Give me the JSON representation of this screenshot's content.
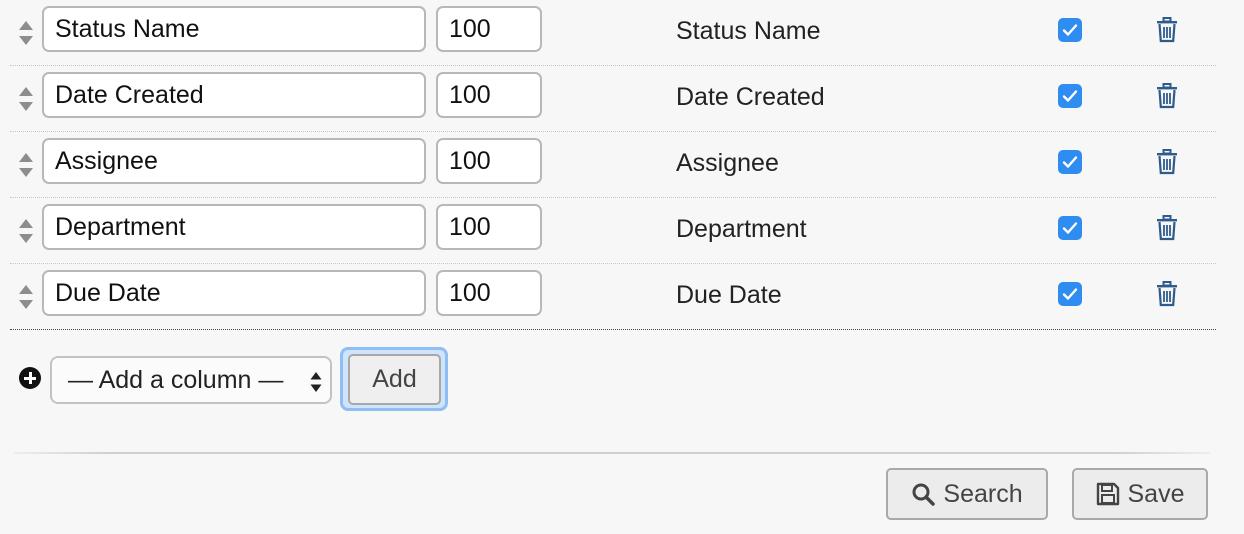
{
  "rows": [
    {
      "name": "Status Name",
      "width": "100",
      "label": "Status Name",
      "checked": true
    },
    {
      "name": "Date Created",
      "width": "100",
      "label": "Date Created",
      "checked": true
    },
    {
      "name": "Assignee",
      "width": "100",
      "label": "Assignee",
      "checked": true
    },
    {
      "name": "Department",
      "width": "100",
      "label": "Department",
      "checked": true
    },
    {
      "name": "Due Date",
      "width": "100",
      "label": "Due Date",
      "checked": true
    }
  ],
  "add_column": {
    "select_value": "— Add a column —",
    "add_label": "Add"
  },
  "footer": {
    "search_label": "Search",
    "save_label": "Save"
  },
  "colors": {
    "checkbox": "#2f8cf0",
    "trash_icon": "#2d5b8c",
    "focus_ring": "#8fbef5"
  },
  "icons": {
    "drag": "sort-icon",
    "checkbox": "checkbox-checked-icon",
    "delete": "trash-icon",
    "add": "plus-circle-icon",
    "search": "search-icon",
    "save": "floppy-disk-icon"
  }
}
